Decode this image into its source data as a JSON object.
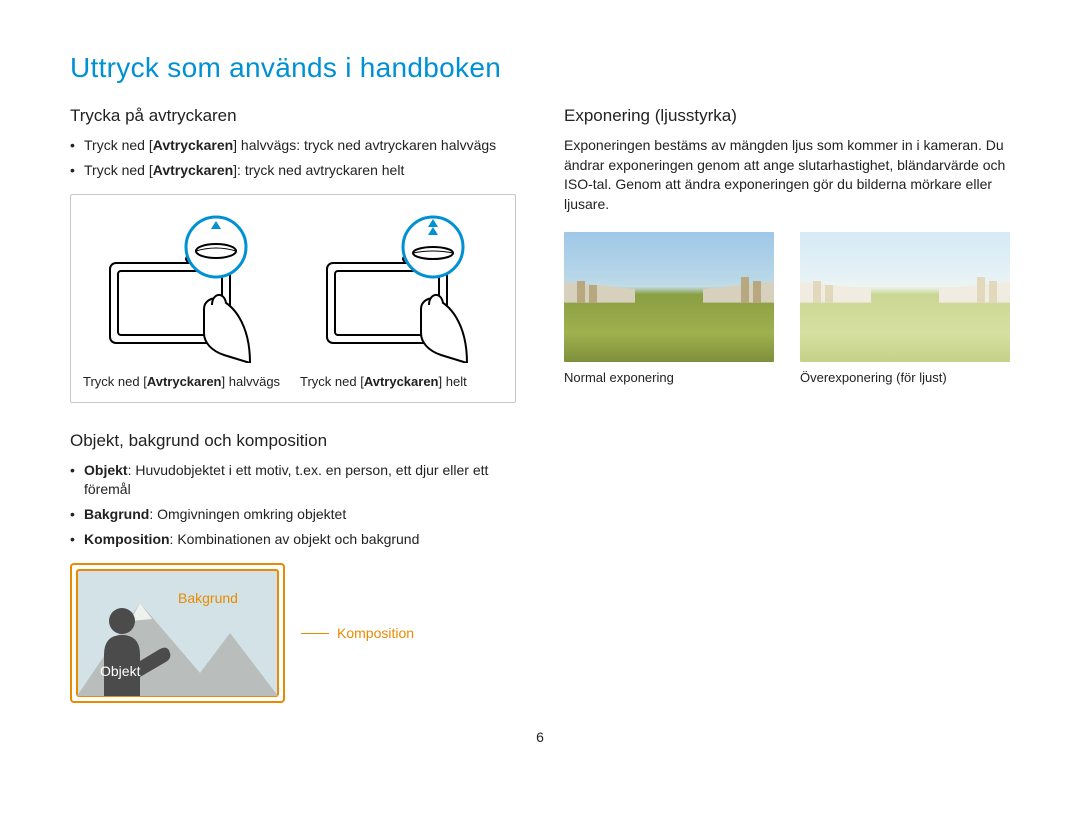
{
  "title": "Uttryck som används i handboken",
  "left": {
    "shutter": {
      "heading": "Trycka på avtryckaren",
      "bullet1_pre": "Tryck ned [",
      "bullet1_bold": "Avtryckaren",
      "bullet1_post": "] halvvägs: tryck ned avtryckaren halvvägs",
      "bullet2_pre": "Tryck ned [",
      "bullet2_bold": "Avtryckaren",
      "bullet2_post": "]: tryck ned avtryckaren helt",
      "cap1_pre": "Tryck ned [",
      "cap1_bold": "Avtryckaren",
      "cap1_post": "] halvvägs",
      "cap2_pre": "Tryck ned [",
      "cap2_bold": "Avtryckaren",
      "cap2_post": "] helt"
    },
    "obj": {
      "heading": "Objekt, bakgrund och komposition",
      "b1_bold": "Objekt",
      "b1_text": ": Huvudobjektet i ett motiv, t.ex. en person, ett djur eller ett föremål",
      "b2_bold": "Bakgrund",
      "b2_text": ": Omgivningen omkring objektet",
      "b3_bold": "Komposition",
      "b3_text": ": Kombinationen av objekt och bakgrund",
      "diagram": {
        "bakgrund": "Bakgrund",
        "objekt": "Objekt",
        "komposition": "Komposition"
      }
    }
  },
  "right": {
    "exposure": {
      "heading": "Exponering (ljusstyrka)",
      "paragraph": "Exponeringen bestäms av mängden ljus som kommer in i kameran. Du ändrar exponeringen genom att ange slutarhastighet, bländarvärde och ISO-tal. Genom att ändra exponeringen gör du bilderna mörkare eller ljusare.",
      "cap_normal": "Normal exponering",
      "cap_over": "Överexponering (för ljust)"
    }
  },
  "page_number": "6"
}
